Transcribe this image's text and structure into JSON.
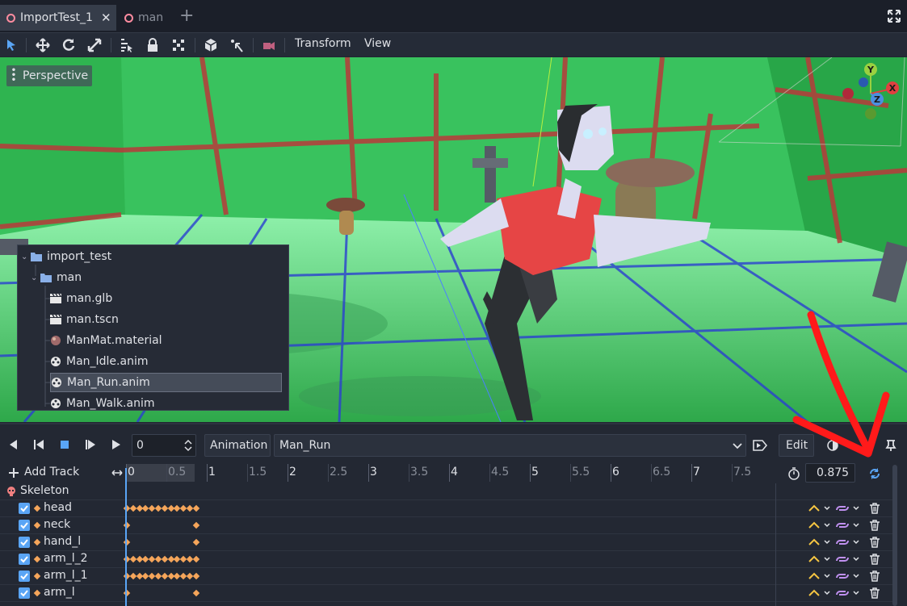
{
  "tabs": [
    {
      "label": "ImportTest_1",
      "active": true
    },
    {
      "label": "man",
      "active": false
    }
  ],
  "toolbar": {
    "transform_label": "Transform",
    "view_label": "View"
  },
  "viewport": {
    "perspective_label": "Perspective",
    "gizmo": {
      "x": "X",
      "y": "Y",
      "z": "Z"
    }
  },
  "filetree": {
    "items": [
      {
        "label": "import_test",
        "type": "folder",
        "level": 0
      },
      {
        "label": "man",
        "type": "folder",
        "level": 1
      },
      {
        "label": "man.glb",
        "type": "scene",
        "level": 2
      },
      {
        "label": "man.tscn",
        "type": "scene",
        "level": 2
      },
      {
        "label": "ManMat.material",
        "type": "material",
        "level": 2
      },
      {
        "label": "Man_Idle.anim",
        "type": "anim",
        "level": 2
      },
      {
        "label": "Man_Run.anim",
        "type": "anim",
        "level": 2,
        "selected": true
      },
      {
        "label": "Man_Walk.anim",
        "type": "anim",
        "level": 2
      }
    ]
  },
  "animation": {
    "time_value": "0",
    "animation_label": "Animation",
    "current_animation": "Man_Run",
    "edit_label": "Edit",
    "add_track_label": "Add Track",
    "length_value": "0.875",
    "ruler": [
      "0",
      "0.5",
      "1",
      "1.5",
      "2",
      "2.5",
      "3",
      "3.5",
      "4",
      "4.5",
      "5",
      "5.5",
      "6",
      "6.5",
      "7",
      "7.5"
    ],
    "root_node": "Skeleton",
    "tracks": [
      {
        "name": "head",
        "dense": true
      },
      {
        "name": "neck",
        "dense": false
      },
      {
        "name": "hand_l",
        "dense": false
      },
      {
        "name": "arm_l_2",
        "dense": true
      },
      {
        "name": "arm_l_1",
        "dense": true
      },
      {
        "name": "arm_l",
        "dense": false
      }
    ]
  },
  "colors": {
    "accent": "#5aa5f5",
    "key": "#f5a55a",
    "annotation_arrow": "#ff1a1a"
  }
}
